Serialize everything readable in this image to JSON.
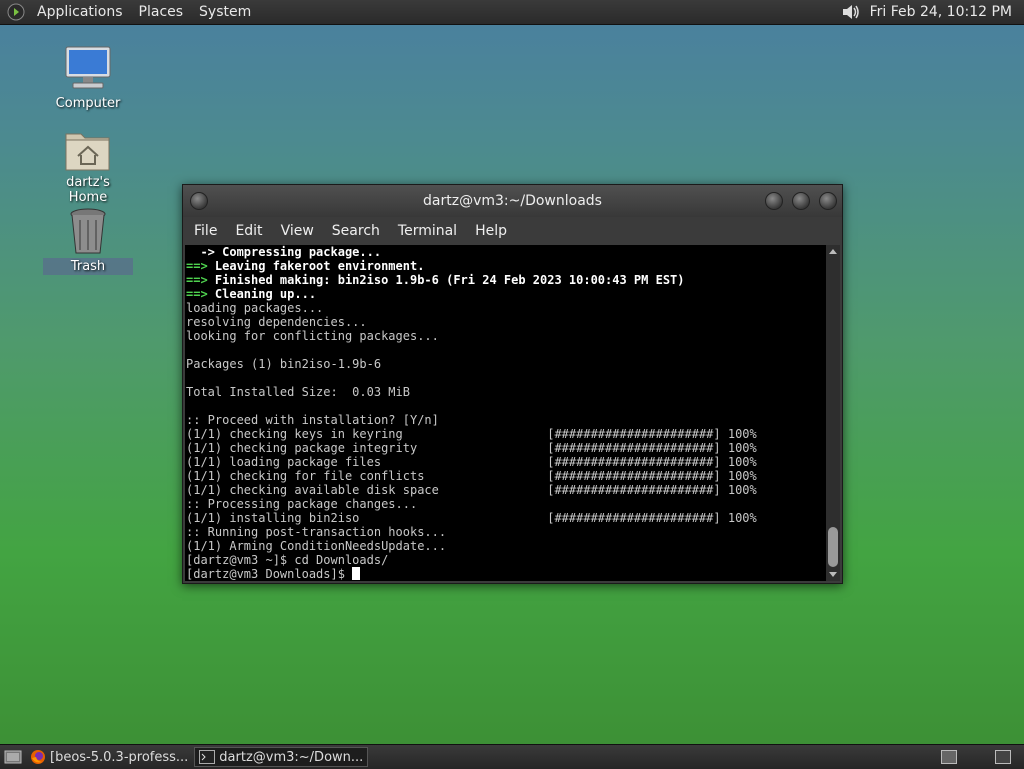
{
  "top_panel": {
    "menus": [
      "Applications",
      "Places",
      "System"
    ],
    "clock": "Fri Feb 24, 10:12 PM",
    "logo_icon": "menu-logo-icon",
    "volume_icon": "speaker-icon"
  },
  "desktop": {
    "icons": [
      {
        "label": "Computer",
        "icon": "computer-icon"
      },
      {
        "label": "dartz's Home",
        "icon": "home-folder-icon"
      },
      {
        "label": "Trash",
        "icon": "trash-icon"
      }
    ]
  },
  "terminal": {
    "title": "dartz@vm3:~/Downloads",
    "menu": [
      "File",
      "Edit",
      "View",
      "Search",
      "Terminal",
      "Help"
    ],
    "lines": [
      {
        "prefix": "  -> ",
        "text": "Compressing package..."
      },
      {
        "prefix": "==> ",
        "text": "Leaving fakeroot environment."
      },
      {
        "prefix": "==> ",
        "text": "Finished making: bin2iso 1.9b-6 (Fri 24 Feb 2023 10:00:43 PM EST)"
      },
      {
        "prefix": "==> ",
        "text": "Cleaning up..."
      },
      {
        "prefix": "",
        "text": "loading packages..."
      },
      {
        "prefix": "",
        "text": "resolving dependencies..."
      },
      {
        "prefix": "",
        "text": "looking for conflicting packages..."
      },
      {
        "prefix": "",
        "text": ""
      },
      {
        "prefix": "",
        "text": "Packages (1) bin2iso-1.9b-6"
      },
      {
        "prefix": "",
        "text": ""
      },
      {
        "prefix": "",
        "text": "Total Installed Size:  0.03 MiB"
      },
      {
        "prefix": "",
        "text": ""
      },
      {
        "prefix": "",
        "text": ":: Proceed with installation? [Y/n]"
      },
      {
        "prefix": "",
        "text": "(1/1) checking keys in keyring                    [######################] 100%"
      },
      {
        "prefix": "",
        "text": "(1/1) checking package integrity                  [######################] 100%"
      },
      {
        "prefix": "",
        "text": "(1/1) loading package files                       [######################] 100%"
      },
      {
        "prefix": "",
        "text": "(1/1) checking for file conflicts                 [######################] 100%"
      },
      {
        "prefix": "",
        "text": "(1/1) checking available disk space               [######################] 100%"
      },
      {
        "prefix": "",
        "text": ":: Processing package changes..."
      },
      {
        "prefix": "",
        "text": "(1/1) installing bin2iso                          [######################] 100%"
      },
      {
        "prefix": "",
        "text": ":: Running post-transaction hooks..."
      },
      {
        "prefix": "",
        "text": "(1/1) Arming ConditionNeedsUpdate..."
      },
      {
        "prefix": "",
        "text": "[dartz@vm3 ~]$ cd Downloads/"
      },
      {
        "prefix": "",
        "text": "[dartz@vm3 Downloads]$ "
      }
    ]
  },
  "taskbar": {
    "tasks": [
      {
        "label": "[beos-5.0.3-profess...",
        "icon": "firefox-icon",
        "active": false
      },
      {
        "label": "dartz@vm3:~/Down...",
        "icon": "terminal-icon",
        "active": true
      }
    ]
  },
  "colors": {
    "prompt_green": "#4fd34f",
    "terminal_bg": "#000000",
    "terminal_fg": "#c8c8c8"
  }
}
